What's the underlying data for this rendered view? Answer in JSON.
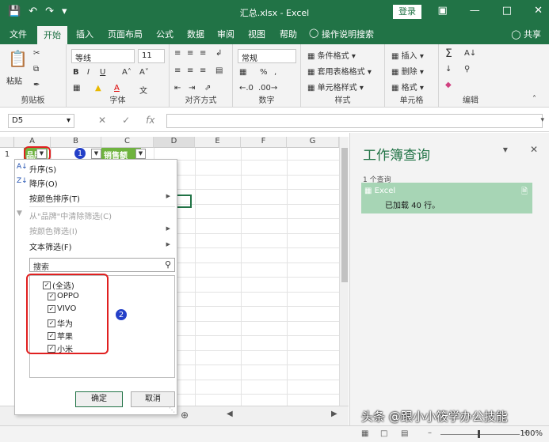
{
  "window": {
    "title": "汇总.xlsx  -  Excel",
    "login_label": "登录"
  },
  "ribbon_tabs": [
    "文件",
    "开始",
    "插入",
    "页面布局",
    "公式",
    "数据",
    "审阅",
    "视图",
    "帮助",
    "操作说明搜索"
  ],
  "share_label": "共享",
  "ribbon": {
    "clipboard": {
      "paste": "粘贴",
      "label": "剪贴板"
    },
    "font": {
      "name": "等线",
      "size": "11",
      "label": "字体"
    },
    "alignment": {
      "label": "对齐方式"
    },
    "number": {
      "format": "常规",
      "label": "数字"
    },
    "styles": {
      "conditional": "条件格式",
      "table": "套用表格格式",
      "cell": "单元格样式",
      "label": "样式"
    },
    "cells": {
      "insert": "插入",
      "delete": "删除",
      "format": "格式",
      "label": "单元格"
    },
    "editing": {
      "label": "编辑"
    }
  },
  "formula_bar": {
    "name_box": "D5",
    "fx": "fx",
    "value": ""
  },
  "columns": [
    "A",
    "B",
    "C",
    "D",
    "E",
    "F",
    "G"
  ],
  "rows": [
    "1"
  ],
  "header_cells": {
    "a1": "品牌",
    "c1": "销售额"
  },
  "badges": {
    "one": "1",
    "two": "2"
  },
  "filter_menu": {
    "sort_asc": "升序(S)",
    "sort_desc": "降序(O)",
    "sort_by_color": "按颜色排序(T)",
    "clear_filter": "从\"品牌\"中清除筛选(C)",
    "filter_by_color": "按颜色筛选(I)",
    "text_filter": "文本筛选(F)",
    "search_placeholder": "搜索",
    "items": [
      "(全选)",
      "OPPO",
      "VIVO",
      "华为",
      "苹果",
      "小米"
    ],
    "ok": "确定",
    "cancel": "取消"
  },
  "query_pane": {
    "title": "工作簿查询",
    "count": "1 个查询",
    "query_name": "Excel",
    "query_status": "已加载 40 行。"
  },
  "status": {
    "zoom": "100%"
  },
  "watermark": "头条 @跟小小筱学办公技能",
  "colors": {
    "excel_green": "#217346",
    "header_fill": "#6fb33f",
    "badge_blue": "#2440c8",
    "highlight_red": "#e02020",
    "query_green": "#a7d5b5"
  }
}
